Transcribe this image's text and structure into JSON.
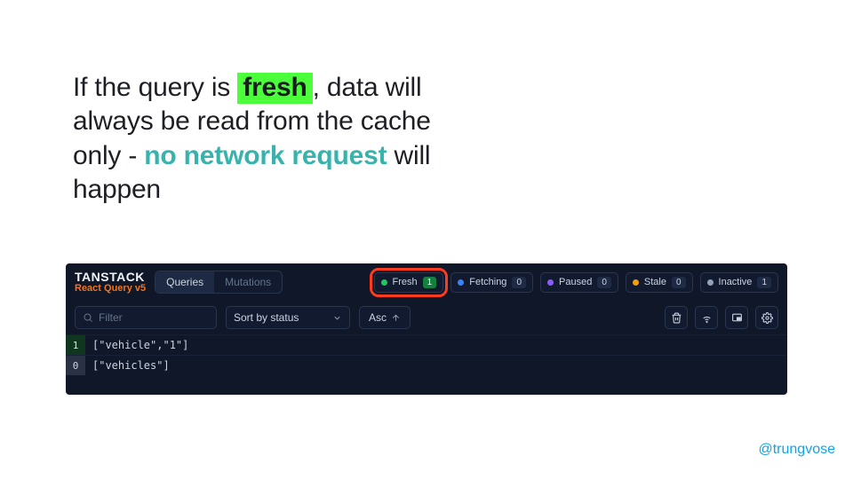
{
  "headline": {
    "t1": "If the query is ",
    "fresh": "fresh",
    "t2": ", data will always be read from the cache only - ",
    "accent": "no network request",
    "t3": " will happen"
  },
  "brand": {
    "main": "TANSTACK",
    "sub": "React Query v5"
  },
  "tabs": {
    "queries": "Queries",
    "mutations": "Mutations"
  },
  "status": {
    "fresh": {
      "label": "Fresh",
      "count": "1"
    },
    "fetching": {
      "label": "Fetching",
      "count": "0"
    },
    "paused": {
      "label": "Paused",
      "count": "0"
    },
    "stale": {
      "label": "Stale",
      "count": "0"
    },
    "inactive": {
      "label": "Inactive",
      "count": "1"
    }
  },
  "controls": {
    "filter_placeholder": "Filter",
    "sort_label": "Sort by status",
    "asc_label": "Asc"
  },
  "rows": [
    {
      "observers": "1",
      "key": "[\"vehicle\",\"1\"]"
    },
    {
      "observers": "0",
      "key": "[\"vehicles\"]"
    }
  ],
  "handle": "@trungvose"
}
